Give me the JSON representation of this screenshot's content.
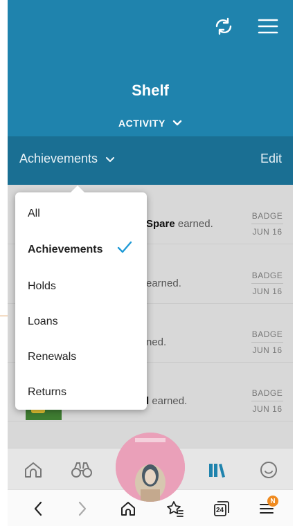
{
  "header": {
    "title": "Shelf",
    "subtitle": "ACTIVITY",
    "bg_color": "#1f83ad"
  },
  "filterbar": {
    "current": "Achievements",
    "edit_label": "Edit"
  },
  "rows": [
    {
      "title_bold": "Spare",
      "suffix": "earned.",
      "type": "BADGE",
      "date": "JUN 16"
    },
    {
      "title_bold": "",
      "suffix": "earned.",
      "type": "BADGE",
      "date": "JUN 16"
    },
    {
      "title_bold": "",
      "suffix": "ned.",
      "type": "BADGE",
      "date": "JUN 16"
    },
    {
      "title_bold": "l",
      "suffix": "earned.",
      "type": "BADGE",
      "date": "JUN 16"
    }
  ],
  "dropdown": {
    "items": [
      "All",
      "Achievements",
      "Holds",
      "Loans",
      "Renewals",
      "Returns"
    ],
    "selected": "Achievements"
  },
  "tabbar": {
    "icons": [
      "home-icon",
      "binoculars-icon",
      "avatar-icon",
      "shelf-icon",
      "smiley-icon"
    ]
  },
  "browserbar": {
    "tabs_count": "24",
    "notification_badge": "N"
  }
}
